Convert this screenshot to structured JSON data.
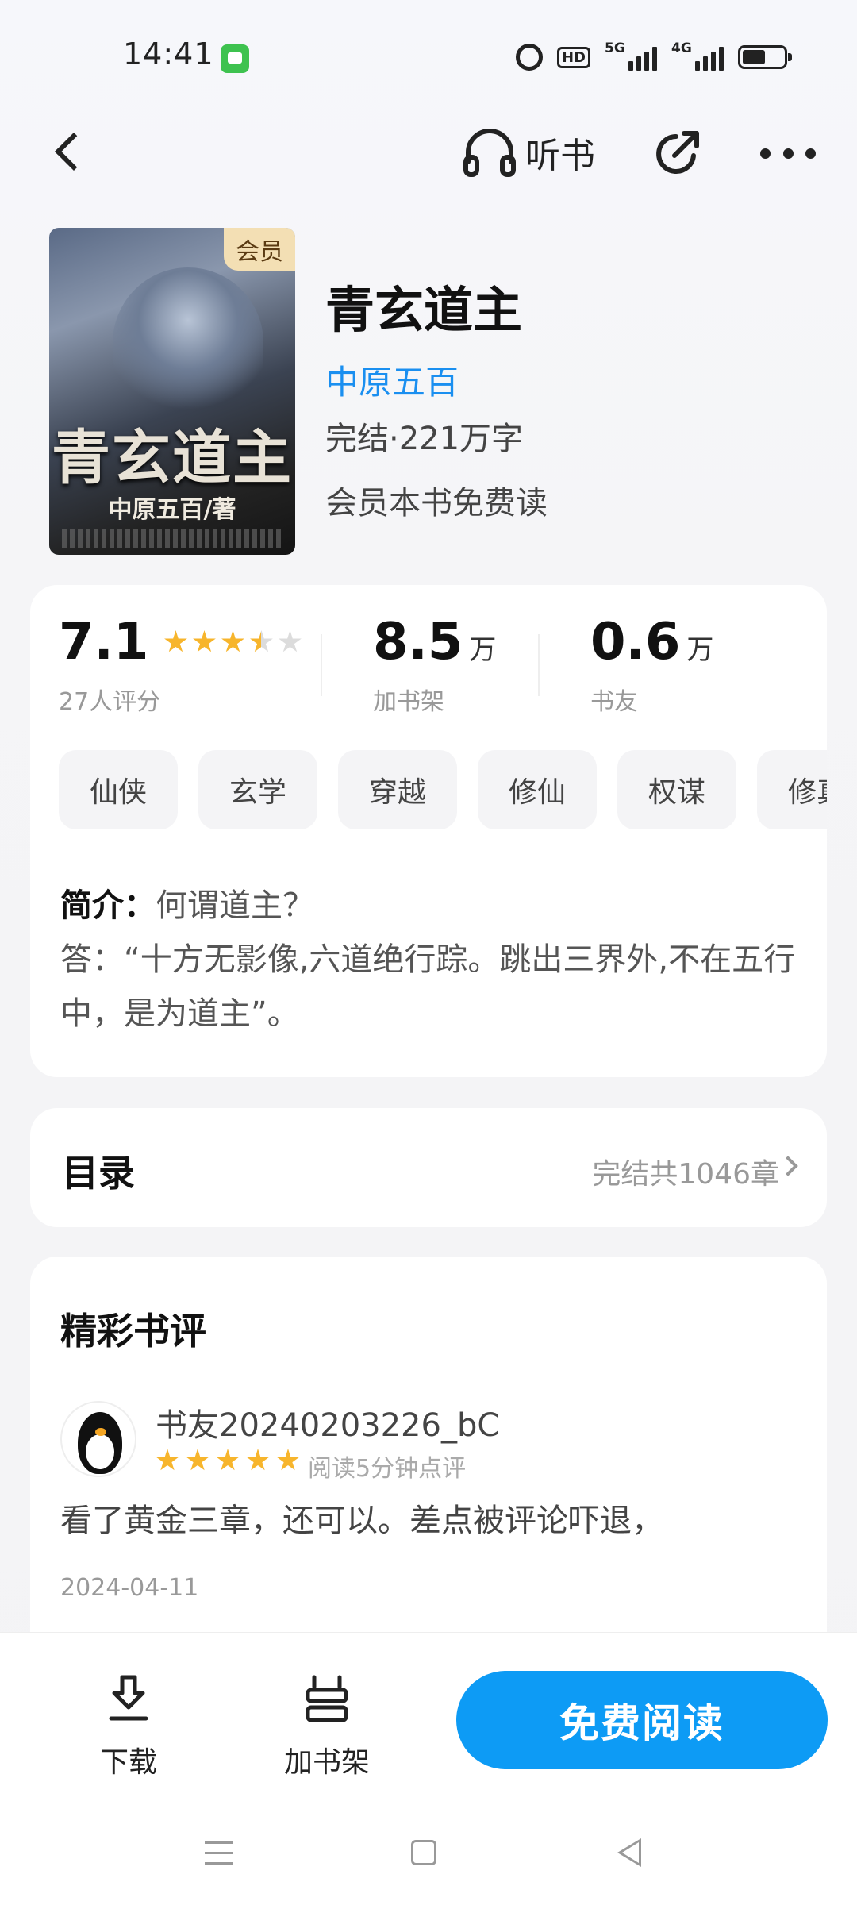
{
  "status_bar": {
    "time": "14:41",
    "hd_label": "HD",
    "net1": "5G",
    "net2": "4G",
    "icons": [
      "message-app-icon",
      "alarm-icon",
      "hd-icon",
      "signal-5g-icon",
      "signal-4g-icon",
      "battery-icon"
    ]
  },
  "nav": {
    "listen_label": "听书",
    "icons": [
      "back-icon",
      "headphones-icon",
      "share-icon",
      "more-icon"
    ]
  },
  "book": {
    "cover_badge": "会员",
    "cover_title": "青玄道主",
    "cover_author": "中原五百/著",
    "title": "青玄道主",
    "author": "中原五百",
    "status": "完结·221万字",
    "member_note": "会员本书免费读"
  },
  "stats": {
    "rating": "7.1",
    "rating_stars": 3.5,
    "rating_label": "27人评分",
    "shelf_value": "8.5",
    "shelf_unit": "万",
    "shelf_label": "加书架",
    "friends_value": "0.6",
    "friends_unit": "万",
    "friends_label": "书友"
  },
  "tags": [
    "仙侠",
    "玄学",
    "穿越",
    "修仙",
    "权谋",
    "修真"
  ],
  "intro": {
    "label": "简介：",
    "line1": "何谓道主？",
    "line2": "答：“十方无影像,六道绝行踪。跳出三界外,不在五行中，是为道主”。"
  },
  "toc": {
    "title": "目录",
    "info": "完结共1046章"
  },
  "reviews": {
    "heading": "精彩书评",
    "items": [
      {
        "name": "书友20240203226_bC",
        "stars": 5,
        "meta": "阅读5分钟点评",
        "text": "看了黄金三章，还可以。差点被评论吓退，",
        "date": "2024-04-11"
      }
    ]
  },
  "bottom_bar": {
    "download_label": "下载",
    "shelf_label": "加书架",
    "read_label": "免费阅读"
  },
  "colors": {
    "accent": "#0d9bf5",
    "author_link": "#1a8ff0",
    "star": "#f7b52c",
    "member_badge": "#f3dfb4"
  }
}
